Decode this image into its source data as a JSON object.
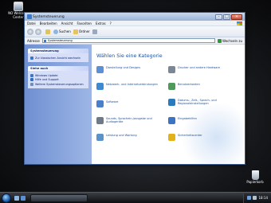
{
  "desktop": {
    "welcome_label": "NO Welcome Center",
    "recycle_label": "Papierkorb"
  },
  "window": {
    "title": "Systemsteuerung",
    "menu": [
      "Datei",
      "Bearbeiten",
      "Ansicht",
      "Favoriten",
      "Extras",
      "?"
    ],
    "toolbar": {
      "back_icon": "back-arrow-icon",
      "search_label": "Suchen",
      "folders_label": "Ordner"
    },
    "address": {
      "label": "Adresse",
      "value": "Systemsteuerung",
      "go_label": "Wechseln zu"
    },
    "sidebar": {
      "control_panel_header": "Systemsteuerung",
      "switch_view_label": "Zur klassischen Ansicht wechseln",
      "see_also_header": "Siehe auch",
      "see_also_items": [
        {
          "label": "Windows Update",
          "color": "#3a79c8"
        },
        {
          "label": "Hilfe und Support",
          "color": "#2f6fc2"
        },
        {
          "label": "Weitere Systemsteuerungsoptionen",
          "color": "#6c8fb7"
        }
      ]
    },
    "main": {
      "title": "Wählen Sie eine Kategorie",
      "categories": [
        {
          "label": "Darstellung und Designs",
          "color": "#5b8fd6"
        },
        {
          "label": "Drucker und andere Hardware",
          "color": "#7a8796"
        },
        {
          "label": "Netzwerk- und Internetverbindungen",
          "color": "#3f89cf"
        },
        {
          "label": "Benutzerkonten",
          "color": "#4f9a5a"
        },
        {
          "label": "Software",
          "color": "#4a7fc9"
        },
        {
          "label": "Datums-, Zeit-, Sprach- und Regionaleinstellungen",
          "color": "#2a7ac0"
        },
        {
          "label": "Sounds, Sprachein-/ausgabe und Audiogeräte",
          "color": "#6d7a8a"
        },
        {
          "label": "Eingabehilfen",
          "color": "#3b74c4"
        },
        {
          "label": "Leistung und Wartung",
          "color": "#5a93c9"
        },
        {
          "label": "Sicherheitscenter",
          "color": "#e2b21a"
        }
      ]
    }
  },
  "taskbar": {
    "clock": "18:14"
  }
}
